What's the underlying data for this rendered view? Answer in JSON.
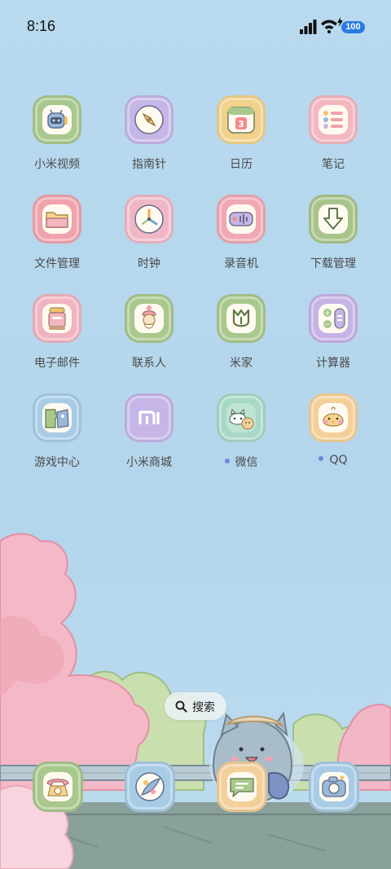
{
  "status_bar": {
    "time": "8:16",
    "battery": "100",
    "signal_icon": "signal-bars-icon",
    "wifi_icon": "wifi-icon"
  },
  "apps": [
    {
      "label": "小米视频",
      "icon": "video-robot-icon",
      "tile_color": "#a9c88d"
    },
    {
      "label": "指南针",
      "icon": "compass-icon",
      "tile_color": "#c6b6e8"
    },
    {
      "label": "日历",
      "icon": "calendar-icon",
      "tile_color": "#f1d28a"
    },
    {
      "label": "笔记",
      "icon": "notes-icon",
      "tile_color": "#f3b7c0"
    },
    {
      "label": "文件管理",
      "icon": "folder-icon",
      "tile_color": "#f0a3ac"
    },
    {
      "label": "时钟",
      "icon": "clock-icon",
      "tile_color": "#efb7c6"
    },
    {
      "label": "录音机",
      "icon": "recorder-icon",
      "tile_color": "#f0a8b4"
    },
    {
      "label": "下载管理",
      "icon": "download-icon",
      "tile_color": "#a9c48a"
    },
    {
      "label": "电子邮件",
      "icon": "mailbox-icon",
      "tile_color": "#f0b4c0"
    },
    {
      "label": "联系人",
      "icon": "contact-person-icon",
      "tile_color": "#a9c88d"
    },
    {
      "label": "米家",
      "icon": "mijia-icon",
      "tile_color": "#a9c88d"
    },
    {
      "label": "计算器",
      "icon": "calculator-icon",
      "tile_color": "#c6b3e6"
    },
    {
      "label": "游戏中心",
      "icon": "game-puzzle-icon",
      "tile_color": "#a8cce6"
    },
    {
      "label": "小米商城",
      "icon": "mi-store-icon",
      "tile_color": "#c6b6e8"
    },
    {
      "label": "微信",
      "icon": "wechat-cat-icon",
      "tile_color": "#a8d8c6",
      "new_dot": true
    },
    {
      "label": "QQ",
      "icon": "qq-chick-icon",
      "tile_color": "#f3d09a",
      "new_dot": true
    }
  ],
  "search": {
    "label": "搜索",
    "icon": "search-icon"
  },
  "dock": [
    {
      "icon": "phone-icon",
      "tile_color": "#a9c88d"
    },
    {
      "icon": "browser-icon",
      "tile_color": "#a8cce6"
    },
    {
      "icon": "messages-icon",
      "tile_color": "#f3d09a"
    },
    {
      "icon": "camera-icon",
      "tile_color": "#a8cce6"
    }
  ]
}
